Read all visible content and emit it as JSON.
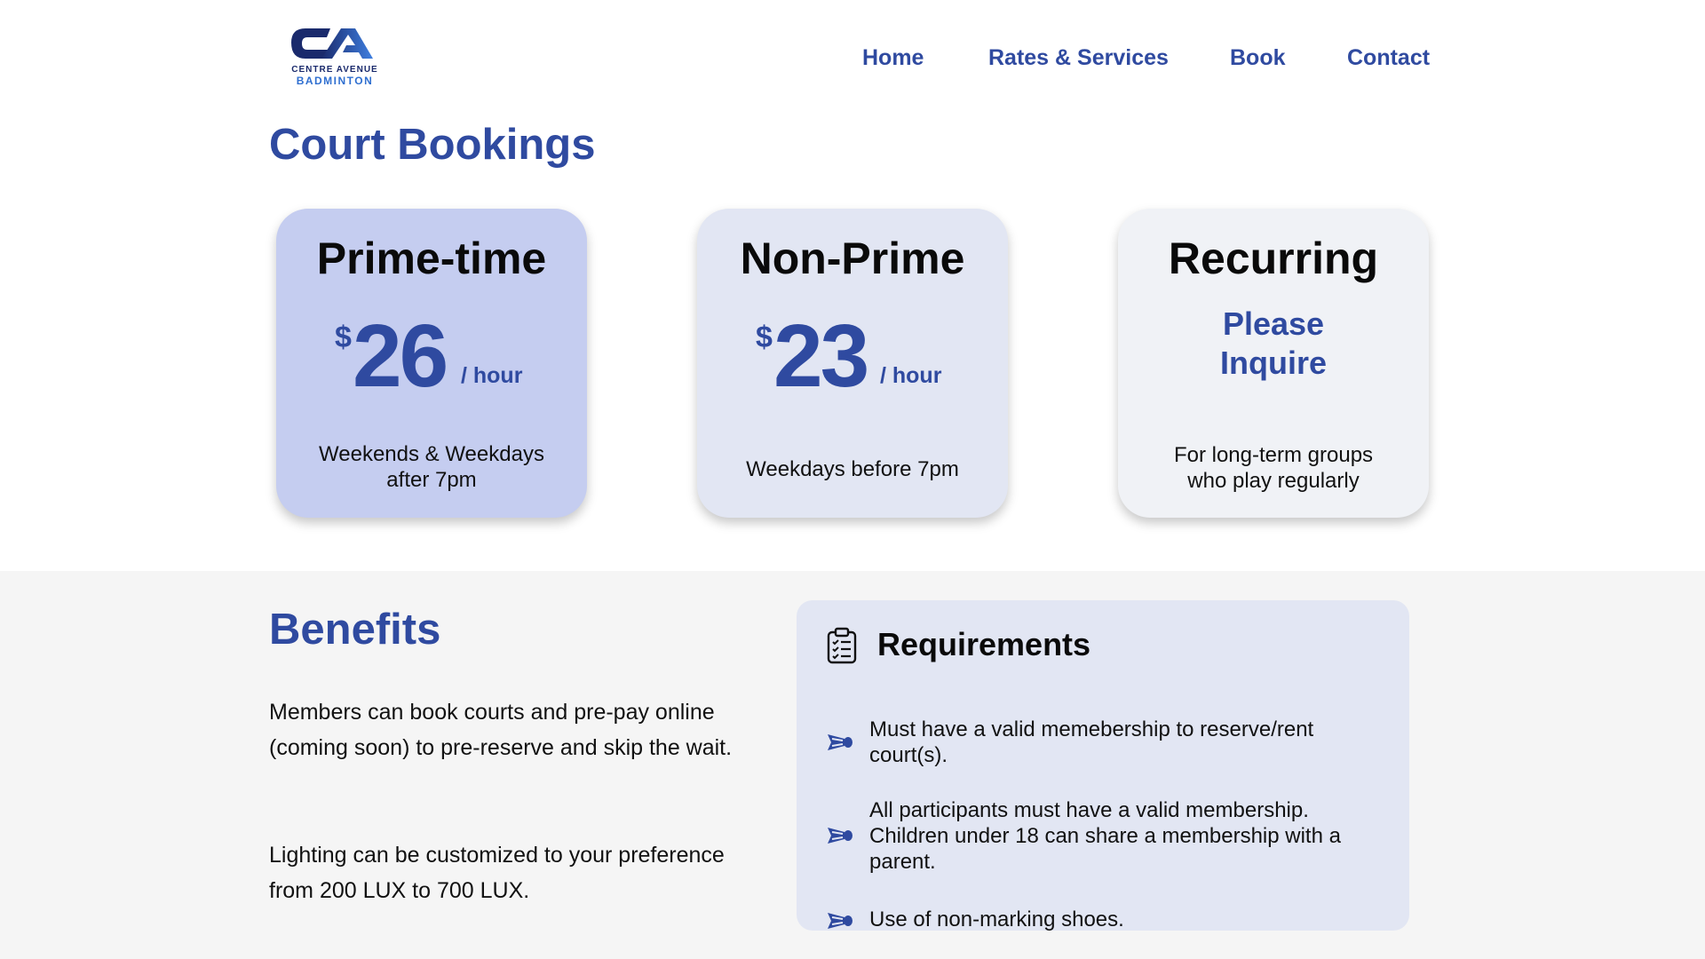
{
  "brand": {
    "logo_text_line1": "CENTRE AVENUE",
    "logo_text_line2": "BADMINTON",
    "logo_mark": "CA"
  },
  "nav": {
    "items": [
      {
        "label": "Home"
      },
      {
        "label": "Rates & Services"
      },
      {
        "label": "Book"
      },
      {
        "label": "Contact"
      }
    ]
  },
  "page_title": "Court Bookings",
  "cards": [
    {
      "title": "Prime-time",
      "currency": "$",
      "amount": "26",
      "unit": "/ hour",
      "desc_line1": "Weekends & Weekdays",
      "desc_line2": "after 7pm",
      "color": "#c5cdf0"
    },
    {
      "title": "Non-Prime",
      "currency": "$",
      "amount": "23",
      "unit": "/ hour",
      "desc_line1": "Weekdays before 7pm",
      "desc_line2": "",
      "color": "#e2e6f3"
    },
    {
      "title": "Recurring",
      "inquire_line1": "Please",
      "inquire_line2": "Inquire",
      "desc_line1": "For long-term groups",
      "desc_line2": "who play regularly",
      "color": "#f0f2f6"
    }
  ],
  "benefits": {
    "title": "Benefits",
    "paragraphs": [
      "Members can book courts and pre-pay online (coming soon) to pre-reserve and skip the wait.",
      "Lighting can be customized to your preference from 200 LUX to 700 LUX."
    ]
  },
  "requirements": {
    "title": "Requirements",
    "icon": "clipboard-checklist-icon",
    "bullet_icon": "shuttlecock-icon",
    "items": [
      "Must have a valid memebership to reserve/rent court(s).",
      "All participants must have a valid membership. Children under 18 can share a membership with a parent.",
      "Use of non-marking shoes."
    ]
  },
  "colors": {
    "accent": "#2f4aa0",
    "section_bg": "#f5f5f5",
    "requirements_bg": "#e2e6f3"
  }
}
